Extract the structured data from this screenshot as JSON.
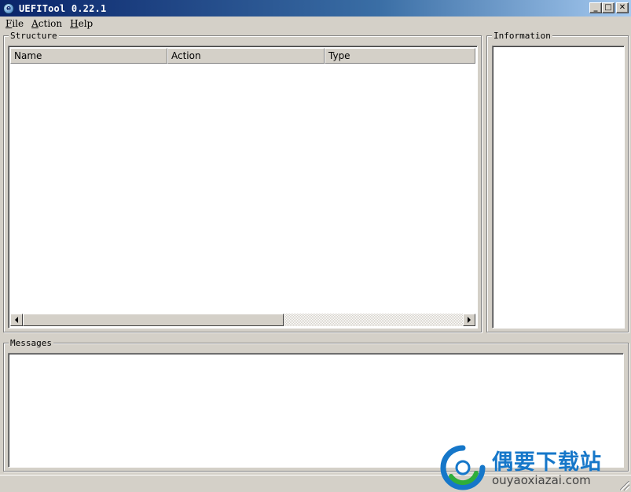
{
  "window": {
    "title": "UEFITool 0.22.1",
    "icon": "app-globe-icon",
    "icon_glyph": "e",
    "buttons": {
      "minimize": "_",
      "maximize": "□",
      "close": "✕"
    },
    "title_gradient": [
      "#0a246a",
      "#a6caf0"
    ]
  },
  "menu": {
    "items": [
      {
        "hot": "F",
        "rest": "ile"
      },
      {
        "hot": "A",
        "rest": "ction"
      },
      {
        "hot": "H",
        "rest": "elp"
      }
    ]
  },
  "structure": {
    "label": "Structure",
    "columns": [
      "Name",
      "Action",
      "Type"
    ]
  },
  "information": {
    "label": "Information"
  },
  "messages": {
    "label": "Messages"
  },
  "watermark": {
    "cn_text": "偶要下载站",
    "en_text": "ouyaoxiazai.com",
    "accent": "#1677c9",
    "logo_colors": [
      "#1677c9",
      "#2fae3a"
    ]
  }
}
